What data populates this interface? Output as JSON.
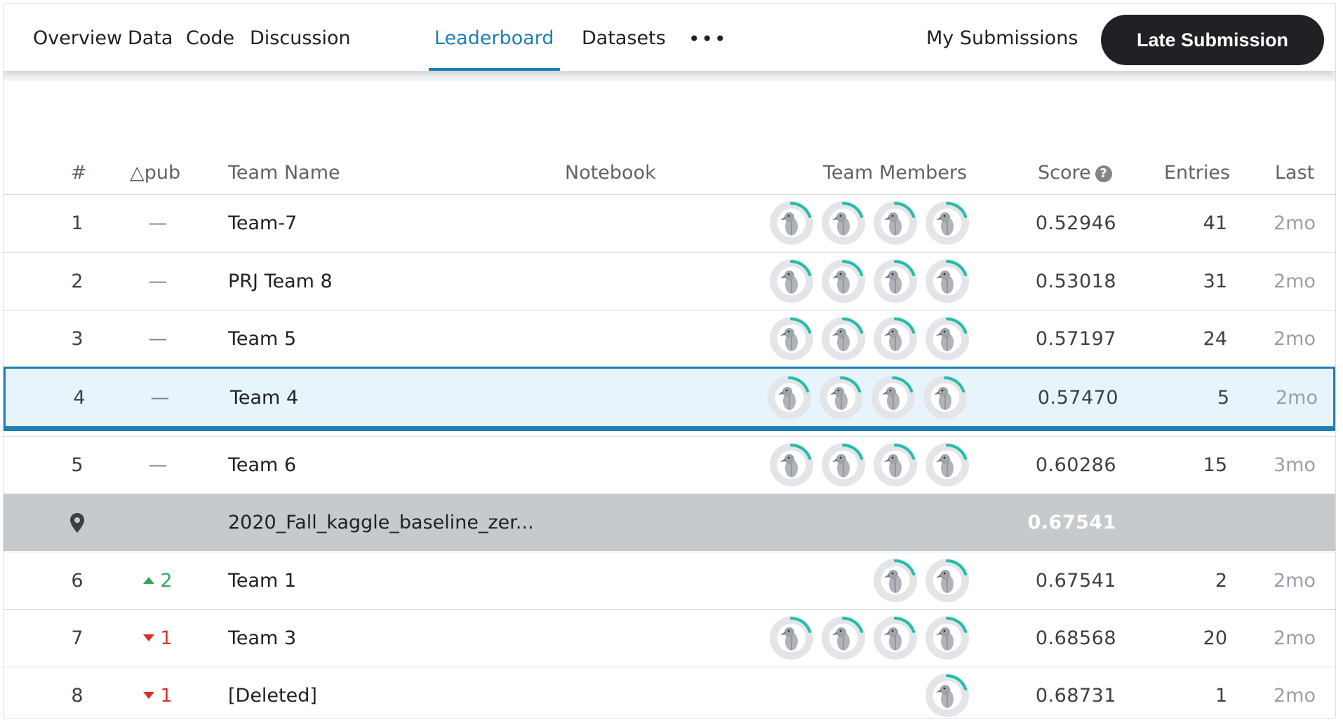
{
  "tabs": [
    {
      "label": "Overview",
      "active": false
    },
    {
      "label": "Data",
      "active": false
    },
    {
      "label": "Code",
      "active": false
    },
    {
      "label": "Discussion",
      "active": false
    },
    {
      "label": "Leaderboard",
      "active": true
    },
    {
      "label": "Datasets",
      "active": false
    }
  ],
  "more_label": "•••",
  "my_submissions_label": "My Submissions",
  "late_submission_label": "Late Submission",
  "columns": {
    "rank": "#",
    "delta": "△pub",
    "team_name": "Team Name",
    "notebook": "Notebook",
    "team_members": "Team Members",
    "score": "Score",
    "entries": "Entries",
    "last": "Last"
  },
  "rows": [
    {
      "rank": "1",
      "delta": "—",
      "delta_dir": "none",
      "team": "Team-7",
      "members": 4,
      "score": "0.52946",
      "entries": "41",
      "last": "2mo"
    },
    {
      "rank": "2",
      "delta": "—",
      "delta_dir": "none",
      "team": "PRJ Team 8",
      "members": 4,
      "score": "0.53018",
      "entries": "31",
      "last": "2mo"
    },
    {
      "rank": "3",
      "delta": "—",
      "delta_dir": "none",
      "team": "Team 5",
      "members": 4,
      "score": "0.57197",
      "entries": "24",
      "last": "2mo"
    },
    {
      "rank": "4",
      "delta": "—",
      "delta_dir": "none",
      "team": "Team 4",
      "members": 4,
      "score": "0.57470",
      "entries": "5",
      "last": "2mo",
      "highlight": true
    },
    {
      "rank": "5",
      "delta": "—",
      "delta_dir": "none",
      "team": "Team 6",
      "members": 4,
      "score": "0.60286",
      "entries": "15",
      "last": "3mo"
    },
    {
      "benchmark": true,
      "icon": "map-pin-icon",
      "team": "2020_Fall_kaggle_baseline_zer...",
      "score": "0.67541"
    },
    {
      "rank": "6",
      "delta": "2",
      "delta_dir": "up",
      "team": "Team 1",
      "members": 2,
      "score": "0.67541",
      "entries": "2",
      "last": "2mo"
    },
    {
      "rank": "7",
      "delta": "1",
      "delta_dir": "down",
      "team": "Team 3",
      "members": 4,
      "score": "0.68568",
      "entries": "20",
      "last": "2mo"
    },
    {
      "rank": "8",
      "delta": "1",
      "delta_dir": "down",
      "team": "[Deleted]",
      "members": 1,
      "score": "0.68731",
      "entries": "1",
      "last": "2mo"
    }
  ],
  "colors": {
    "accent": "#1d7fb3",
    "highlight_bg": "#e8f4fb",
    "benchmark_bg": "#c6cacd",
    "up": "#34a853",
    "down": "#d93025",
    "avatar_ring": "#20beaa"
  }
}
